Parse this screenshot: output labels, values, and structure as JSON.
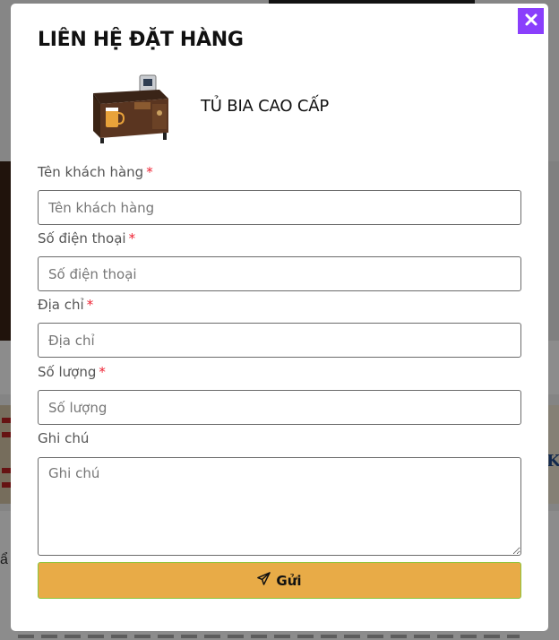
{
  "background": {
    "left_fragment_text": "ẩ",
    "right_logo_glyph": "K"
  },
  "modal": {
    "title": "LIÊN HỆ ĐẶT HÀNG",
    "close_icon": "close-icon",
    "accent_color": "#8a3ffc",
    "product": {
      "name": "TỦ BIA CAO CẤP",
      "image_icon": "beer-cabinet-image"
    },
    "fields": [
      {
        "label": "Tên khách hàng",
        "required": true,
        "placeholder": "Tên khách hàng",
        "value": ""
      },
      {
        "label": "Số điện thoại",
        "required": true,
        "placeholder": "Số điện thoại",
        "value": ""
      },
      {
        "label": "Địa chỉ",
        "required": true,
        "placeholder": "Địa chỉ",
        "value": ""
      },
      {
        "label": "Số lượng",
        "required": true,
        "placeholder": "Số lượng",
        "value": ""
      }
    ],
    "note": {
      "label": "Ghi chú",
      "placeholder": "Ghi chú",
      "value": ""
    },
    "required_mark": "*",
    "submit": {
      "label": "Gửi",
      "icon": "paper-plane-icon",
      "bg_color": "#e8ab47",
      "border_color": "#8dc53e"
    }
  }
}
